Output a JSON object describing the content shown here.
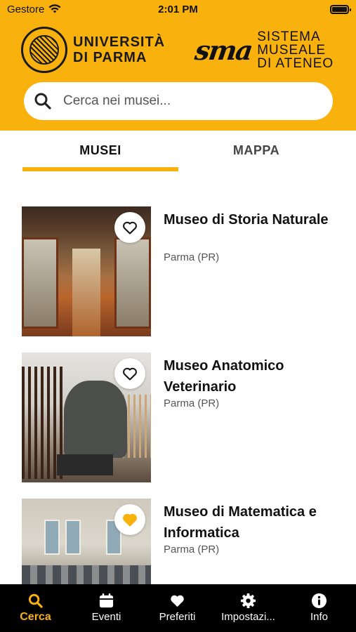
{
  "status_bar": {
    "carrier": "Gestore",
    "time": "2:01 PM"
  },
  "header": {
    "university_name_line1": "UNIVERSITÀ",
    "university_name_line2": "DI PARMA",
    "sma_script": "sma",
    "sma_line1": "SISTEMA",
    "sma_line2": "MUSEALE",
    "sma_line3": "DI ATENEO",
    "accent_color": "#F9B20D"
  },
  "search": {
    "placeholder": "Cerca nei musei...",
    "value": ""
  },
  "tabs": [
    {
      "label": "MUSEI",
      "active": true
    },
    {
      "label": "MAPPA",
      "active": false
    }
  ],
  "museums": [
    {
      "name": "Museo di Storia Naturale",
      "location": "Parma (PR)",
      "favorite": false,
      "favorite_icon": "heart-outline-icon"
    },
    {
      "name": "Museo Anatomico Veterinario",
      "location": "Parma (PR)",
      "favorite": false,
      "favorite_icon": "heart-outline-icon"
    },
    {
      "name": "Museo di Matematica e Informatica",
      "location": "Parma (PR)",
      "favorite": true,
      "favorite_icon": "heart-filled-icon"
    }
  ],
  "tabbar": [
    {
      "label": "Cerca",
      "icon": "search-icon",
      "active": true
    },
    {
      "label": "Eventi",
      "icon": "calendar-icon",
      "active": false
    },
    {
      "label": "Preferiti",
      "icon": "heart-icon",
      "active": false
    },
    {
      "label": "Impostazi...",
      "icon": "gear-icon",
      "active": false
    },
    {
      "label": "Info",
      "icon": "info-icon",
      "active": false
    }
  ]
}
